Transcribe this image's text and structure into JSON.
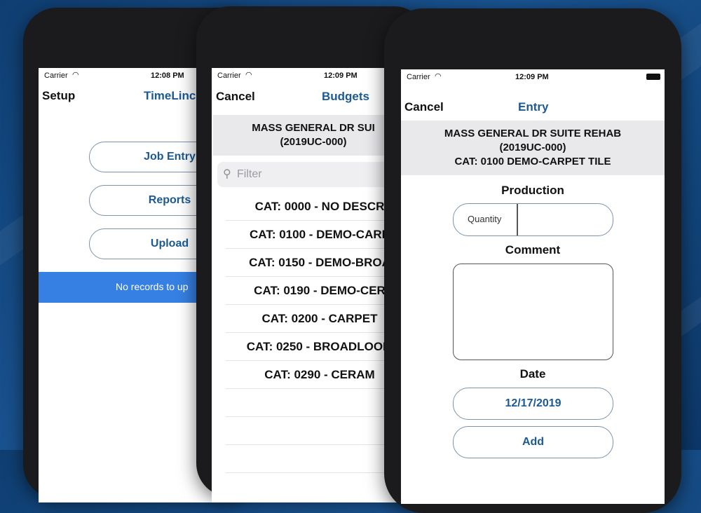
{
  "phone1": {
    "status": {
      "carrier": "Carrier",
      "time": "12:08 PM"
    },
    "nav": {
      "left": "Setup",
      "title": "TimeLinc"
    },
    "buttons": {
      "job_entry": "Job Entry",
      "reports": "Reports",
      "upload": "Upload"
    },
    "banner": "No records to up"
  },
  "phone2": {
    "status": {
      "carrier": "Carrier",
      "time": "12:09 PM"
    },
    "nav": {
      "left": "Cancel",
      "title": "Budgets"
    },
    "header": {
      "line1": "MASS GENERAL DR SUI",
      "line2": "(2019UC-000)"
    },
    "filter_placeholder": "Filter",
    "rows": [
      "CAT: 0000 - NO DESCR",
      "CAT: 0100 - DEMO-CARP",
      "CAT: 0150 - DEMO-BROA",
      "CAT: 0190 - DEMO-CER",
      "CAT: 0200 - CARPET",
      "CAT: 0250 - BROADLOOM",
      "CAT: 0290 - CERAM"
    ]
  },
  "phone3": {
    "status": {
      "carrier": "Carrier",
      "time": "12:09 PM"
    },
    "nav": {
      "left": "Cancel",
      "title": "Entry"
    },
    "header": {
      "line1": "MASS GENERAL DR SUITE REHAB",
      "line2": "(2019UC-000)",
      "line3": "CAT: 0100 DEMO-CARPET TILE"
    },
    "production_label": "Production",
    "quantity_label": "Quantity",
    "quantity_value": "",
    "comment_label": "Comment",
    "comment_value": "",
    "date_label": "Date",
    "date_value": "12/17/2019",
    "add_label": "Add"
  },
  "colors": {
    "accent": "#1b5a93",
    "banner": "#3680e3",
    "background": "#14487f"
  },
  "icons": [
    "wifi-icon",
    "battery-icon",
    "search-icon"
  ]
}
